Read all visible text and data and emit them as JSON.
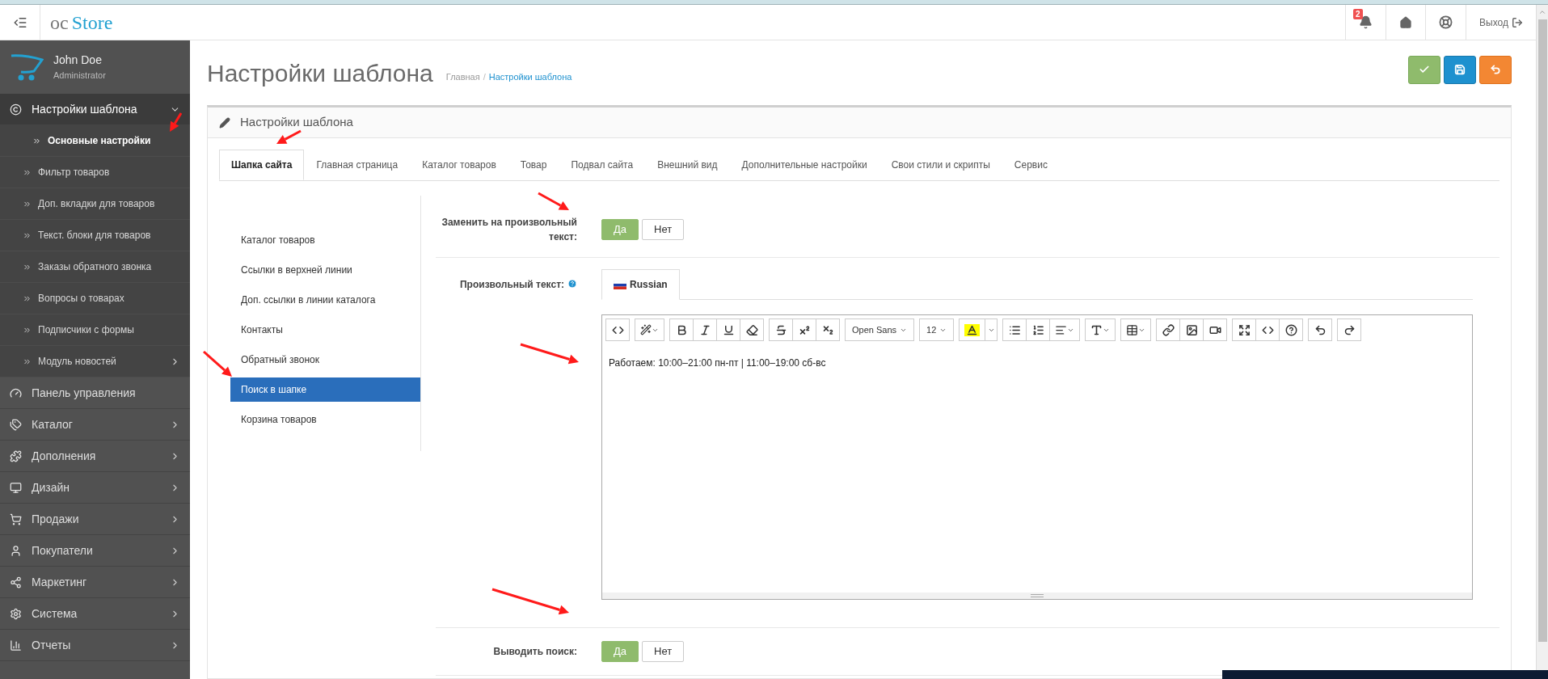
{
  "topbar": {
    "logo": {
      "prefix": "oc",
      "name": "Store"
    },
    "notification_count": "2",
    "logout": "Выход"
  },
  "user": {
    "name": "John Doe",
    "role": "Administrator"
  },
  "sidebar": {
    "items": [
      {
        "label": "Настройки шаблона",
        "has_submenu": true,
        "expanded": true,
        "children": [
          {
            "label": "Основные настройки",
            "selected": true,
            "has_submenu": false
          },
          {
            "label": "Фильтр товаров",
            "selected": false,
            "has_submenu": false
          },
          {
            "label": "Доп. вкладки для товаров",
            "selected": false,
            "has_submenu": false
          },
          {
            "label": "Текст. блоки для товаров",
            "selected": false,
            "has_submenu": false
          },
          {
            "label": "Заказы обратного звонка",
            "selected": false,
            "has_submenu": false
          },
          {
            "label": "Вопросы о товарах",
            "selected": false,
            "has_submenu": false
          },
          {
            "label": "Подписчики с формы",
            "selected": false,
            "has_submenu": false
          },
          {
            "label": "Модуль новостей",
            "selected": false,
            "has_submenu": true
          }
        ]
      },
      {
        "label": "Панель управления",
        "has_submenu": false,
        "expanded": false
      },
      {
        "label": "Каталог",
        "has_submenu": true,
        "expanded": false
      },
      {
        "label": "Дополнения",
        "has_submenu": true,
        "expanded": false
      },
      {
        "label": "Дизайн",
        "has_submenu": true,
        "expanded": false
      },
      {
        "label": "Продажи",
        "has_submenu": true,
        "expanded": false
      },
      {
        "label": "Покупатели",
        "has_submenu": true,
        "expanded": false
      },
      {
        "label": "Маркетинг",
        "has_submenu": true,
        "expanded": false
      },
      {
        "label": "Система",
        "has_submenu": true,
        "expanded": false
      },
      {
        "label": "Отчеты",
        "has_submenu": true,
        "expanded": false
      }
    ]
  },
  "page": {
    "title": "Настройки шаблона",
    "breadcrumb_separator": "/",
    "breadcrumbs": [
      {
        "label": "Главная",
        "current": false
      },
      {
        "label": "Настройки шаблона",
        "current": true
      }
    ],
    "actions": [
      {
        "kind": "apply"
      },
      {
        "kind": "save"
      },
      {
        "kind": "back"
      }
    ]
  },
  "panel": {
    "title": "Настройки шаблона",
    "tabs": [
      {
        "label": "Шапка сайта",
        "selected": true
      },
      {
        "label": "Главная страница",
        "selected": false
      },
      {
        "label": "Каталог товаров",
        "selected": false
      },
      {
        "label": "Товар",
        "selected": false
      },
      {
        "label": "Подвал сайта",
        "selected": false
      },
      {
        "label": "Внешний вид",
        "selected": false
      },
      {
        "label": "Дополнительные настройки",
        "selected": false
      },
      {
        "label": "Свои стили и скрипты",
        "selected": false
      },
      {
        "label": "Сервис",
        "selected": false
      }
    ],
    "side_tabs": [
      {
        "label": "Каталог товаров",
        "selected": false
      },
      {
        "label": "Ссылки в верхней линии",
        "selected": false
      },
      {
        "label": "Доп. ссылки в линии каталога",
        "selected": false
      },
      {
        "label": "Контакты",
        "selected": false
      },
      {
        "label": "Обратный звонок",
        "selected": false
      },
      {
        "label": "Поиск в шапке",
        "selected": true
      },
      {
        "label": "Корзина товаров",
        "selected": false
      }
    ],
    "fields": [
      {
        "kind": "toggle",
        "label": "Заменить на произвольный текст:",
        "options": [
          {
            "label": "Да",
            "selected": true
          },
          {
            "label": "Нет",
            "selected": false
          }
        ]
      },
      {
        "kind": "editor",
        "label": "Произвольный текст:",
        "help": true,
        "languages": [
          {
            "label": "Russian",
            "selected": true
          }
        ],
        "font_name": "Open Sans",
        "font_size": "12",
        "content": "Работаем: 10:00–21:00 пн-пт | 11:00–19:00 сб-вс"
      },
      {
        "kind": "toggle",
        "label": "Выводить поиск:",
        "options": [
          {
            "label": "Да",
            "selected": true
          },
          {
            "label": "Нет",
            "selected": false
          }
        ]
      }
    ]
  }
}
